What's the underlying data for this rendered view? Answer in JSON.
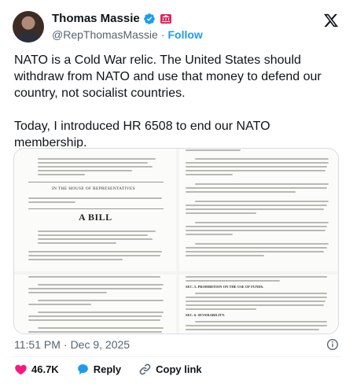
{
  "author": {
    "name": "Thomas Massie",
    "handle": "@RepThomasMassie",
    "separator": "·",
    "follow_label": "Follow",
    "flag_label": "🏛"
  },
  "tweet": {
    "text": "NATO is a Cold War relic. The United States should withdraw from NATO and use that money to defend our country, not socialist countries.\n\nToday, I introduced HR 6508 to end our NATO membership."
  },
  "document": {
    "house_heading": "IN THE HOUSE OF REPRESENTATIVES",
    "bill_title": "A BILL",
    "section_prohibition": "SEC. 5. PROHIBITION ON THE USE OF FUNDS.",
    "section_severability": "SEC. 6. SEVERABILITY."
  },
  "meta": {
    "time": "11:51 PM",
    "separator": "·",
    "date": "Dec 9, 2025"
  },
  "actions": {
    "likes": "46.7K",
    "reply_label": "Reply",
    "copy_label": "Copy link"
  },
  "colors": {
    "like": "#f91880",
    "link": "#1d9bf0",
    "verified": "#1d9bf0",
    "muted": "#536471"
  }
}
